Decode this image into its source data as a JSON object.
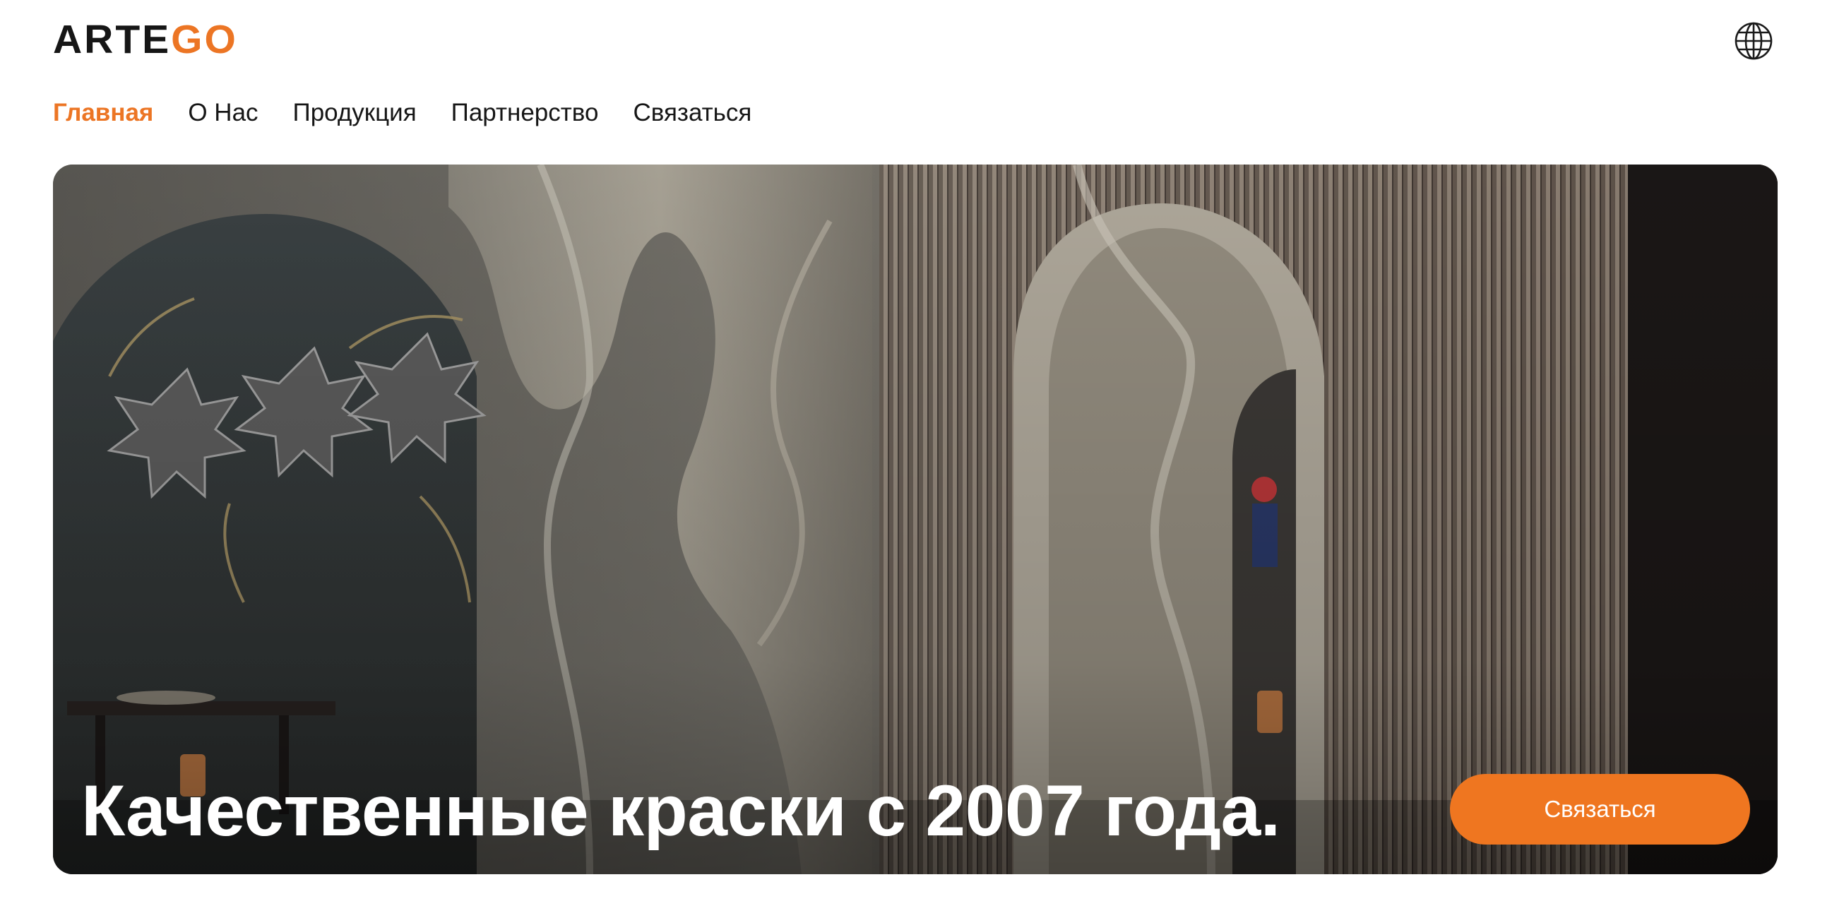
{
  "header": {
    "logo": {
      "dark_part": "ARTE",
      "accent_part": "GO"
    },
    "language_icon": "globe-icon"
  },
  "nav": {
    "items": [
      {
        "label": "Главная",
        "active": true
      },
      {
        "label": "О Нас",
        "active": false
      },
      {
        "label": "Продукция",
        "active": false
      },
      {
        "label": "Партнерство",
        "active": false
      },
      {
        "label": "Связаться",
        "active": false
      }
    ]
  },
  "hero": {
    "title": "Качественные краски с 2007 года.",
    "cta_label": "Связаться"
  },
  "colors": {
    "accent": "#ec7524",
    "text": "#161616",
    "background": "#ffffff"
  }
}
